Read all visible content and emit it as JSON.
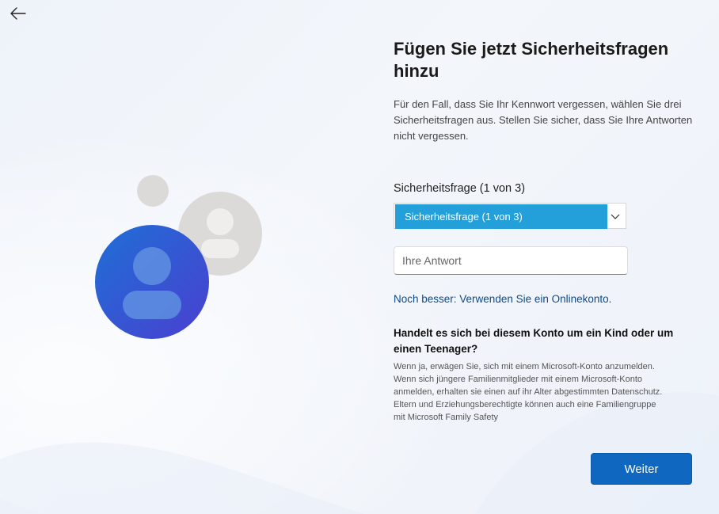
{
  "nav": {
    "back_icon": "arrow-left-icon"
  },
  "illustration": {
    "icon": "users-icon",
    "colors": {
      "primary": "#2b5bd8",
      "secondary": "#dcdad8"
    }
  },
  "main": {
    "title": "Fügen Sie jetzt Sicherheitsfragen hinzu",
    "description": "Für den Fall, dass Sie Ihr Kennwort vergessen, wählen Sie drei Sicherheitsfragen aus. Stellen Sie sicher, dass Sie Ihre Antworten nicht vergessen.",
    "question_label": "Sicherheitsfrage (1 von 3)",
    "question_select_value": "Sicherheitsfrage (1 von 3)",
    "answer_placeholder": "Ihre Antwort",
    "online_account_link": "Noch besser: Verwenden Sie ein Onlinekonto.",
    "kid_heading": "Handelt es sich bei diesem Konto um ein Kind oder um einen Teenager?",
    "kid_text": "Wenn ja, erwägen Sie, sich mit einem Microsoft-Konto anzumelden. Wenn sich jüngere Familienmitglieder mit einem Microsoft-Konto anmelden, erhalten sie einen auf ihr Alter abgestimmten Datenschutz. Eltern und Erziehungsberechtigte können auch eine Familiengruppe mit Microsoft Family Safety"
  },
  "footer": {
    "next_label": "Weiter"
  },
  "colors": {
    "accent": "#0f67c0",
    "select_highlight": "#239fd9",
    "link": "#0b4a8a"
  }
}
